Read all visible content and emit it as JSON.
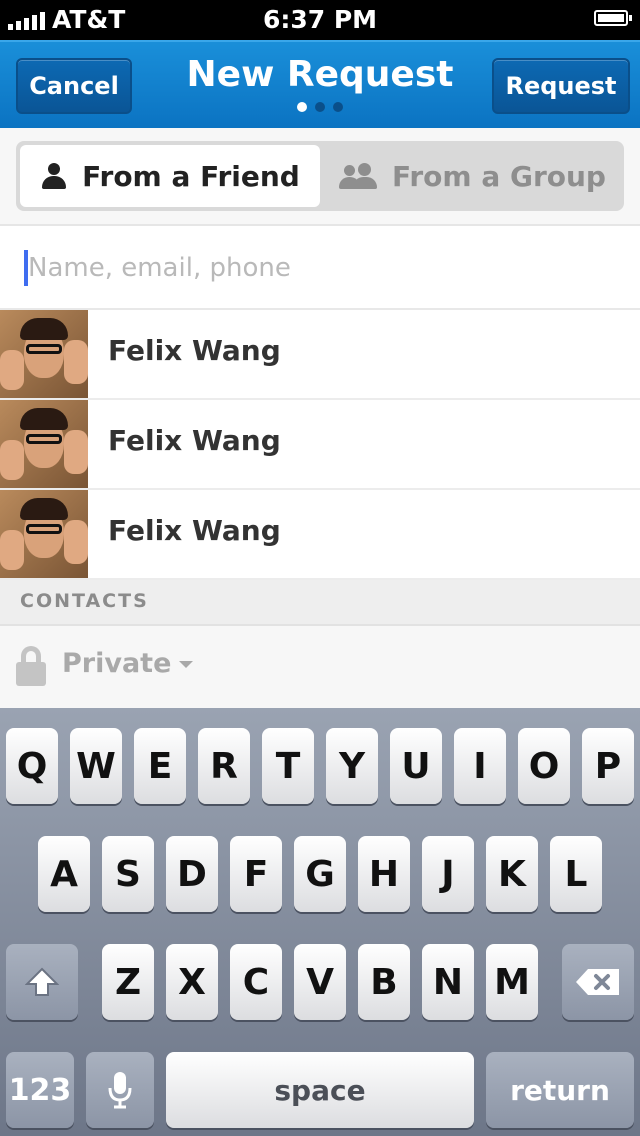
{
  "status_bar": {
    "carrier": "AT&T",
    "time": "6:37 PM"
  },
  "nav": {
    "cancel_label": "Cancel",
    "title": "New Request",
    "request_label": "Request",
    "pager": {
      "count": 3,
      "active_index": 0
    }
  },
  "segment": {
    "from_friend_label": "From a Friend",
    "from_group_label": "From a Group",
    "selected": "From a Friend"
  },
  "search": {
    "placeholder": "Name, email, phone",
    "value": ""
  },
  "contacts": [
    {
      "name": "Felix Wang"
    },
    {
      "name": "Felix Wang"
    },
    {
      "name": "Felix Wang"
    }
  ],
  "section_header": "CONTACTS",
  "privacy": {
    "label": "Private"
  },
  "keyboard": {
    "row1": [
      "Q",
      "W",
      "E",
      "R",
      "T",
      "Y",
      "U",
      "I",
      "O",
      "P"
    ],
    "row2": [
      "A",
      "S",
      "D",
      "F",
      "G",
      "H",
      "J",
      "K",
      "L"
    ],
    "row3": [
      "Z",
      "X",
      "C",
      "V",
      "B",
      "N",
      "M"
    ],
    "numbers_label": "123",
    "space_label": "space",
    "return_label": "return"
  },
  "colors": {
    "nav_blue": "#0b73c2",
    "accent_caret": "#3f6df0"
  }
}
